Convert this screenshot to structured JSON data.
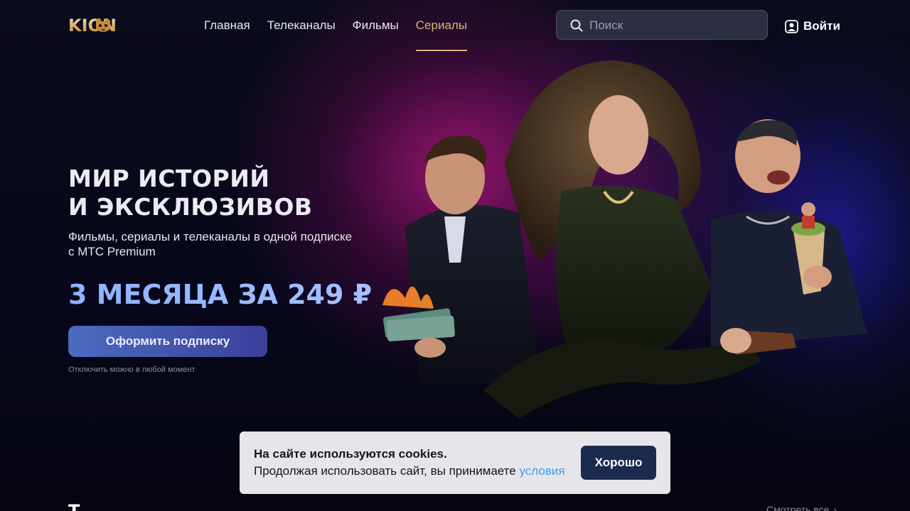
{
  "header": {
    "logo_text": "KION",
    "nav": [
      {
        "label": "Главная"
      },
      {
        "label": "Телеканалы"
      },
      {
        "label": "Фильмы"
      },
      {
        "label": "Сериалы",
        "active": true
      }
    ],
    "search": {
      "placeholder": "Поиск",
      "value": "",
      "icon": "search-icon"
    },
    "login": {
      "label": "Войти",
      "icon": "user-icon"
    }
  },
  "hero": {
    "title_line1": "МИР ИСТОРИЙ",
    "title_line2": "И ЭКСКЛЮЗИВОВ",
    "subtitle_line1": "Фильмы, сериалы и телеканалы в одной подписке",
    "subtitle_line2": "с МТС Premium",
    "offer": "3 МЕСЯЦА ЗА 249 ₽",
    "cta_label": "Оформить подписку",
    "cta_note": "Отключить можно в любой момент"
  },
  "cookie": {
    "title": "На сайте используются cookies.",
    "text": "Продолжая использовать сайт, вы принимаете",
    "link": "условия",
    "button": "Хорошо"
  },
  "section": {
    "title": "Т",
    "see_all": "Смотреть все"
  },
  "colors": {
    "accent_gold": "#d9b57a",
    "offer_blue": "#8fb4ff",
    "cta_start": "#4b6cc0",
    "cta_end": "#3b3f9a",
    "cookie_button": "#1c2a4d",
    "link": "#3aa2e8"
  }
}
